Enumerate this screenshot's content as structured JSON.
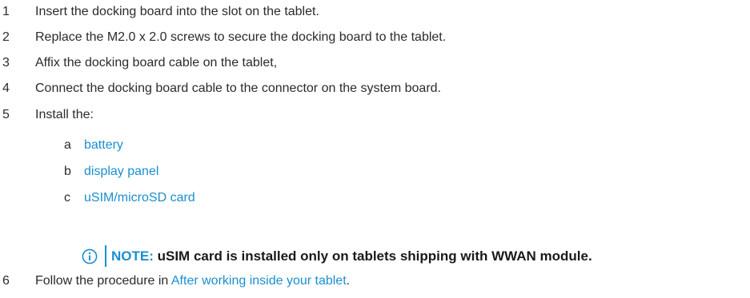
{
  "steps": [
    {
      "number": "1",
      "text": "Insert the docking board into the slot on the tablet."
    },
    {
      "number": "2",
      "text": "Replace the M2.0 x 2.0 screws to secure the docking board to the tablet."
    },
    {
      "number": "3",
      "text": "Affix the docking board cable on the tablet,"
    },
    {
      "number": "4",
      "text": "Connect the docking board cable to the connector on the system board."
    },
    {
      "number": "5",
      "text": "Install the:"
    }
  ],
  "substeps": [
    {
      "letter": "a",
      "link": "battery"
    },
    {
      "letter": "b",
      "link": "display panel"
    },
    {
      "letter": "c",
      "link": "uSIM/microSD card"
    }
  ],
  "note": {
    "icon": "info-icon",
    "label": "NOTE:",
    "text": " uSIM card is installed only on tablets shipping with WWAN module."
  },
  "last_step": {
    "number": "6",
    "prefix": "Follow the procedure in ",
    "link": "After working inside your tablet",
    "suffix": "."
  },
  "colors": {
    "link": "#1a8fcf",
    "text": "#2b2b2b"
  }
}
